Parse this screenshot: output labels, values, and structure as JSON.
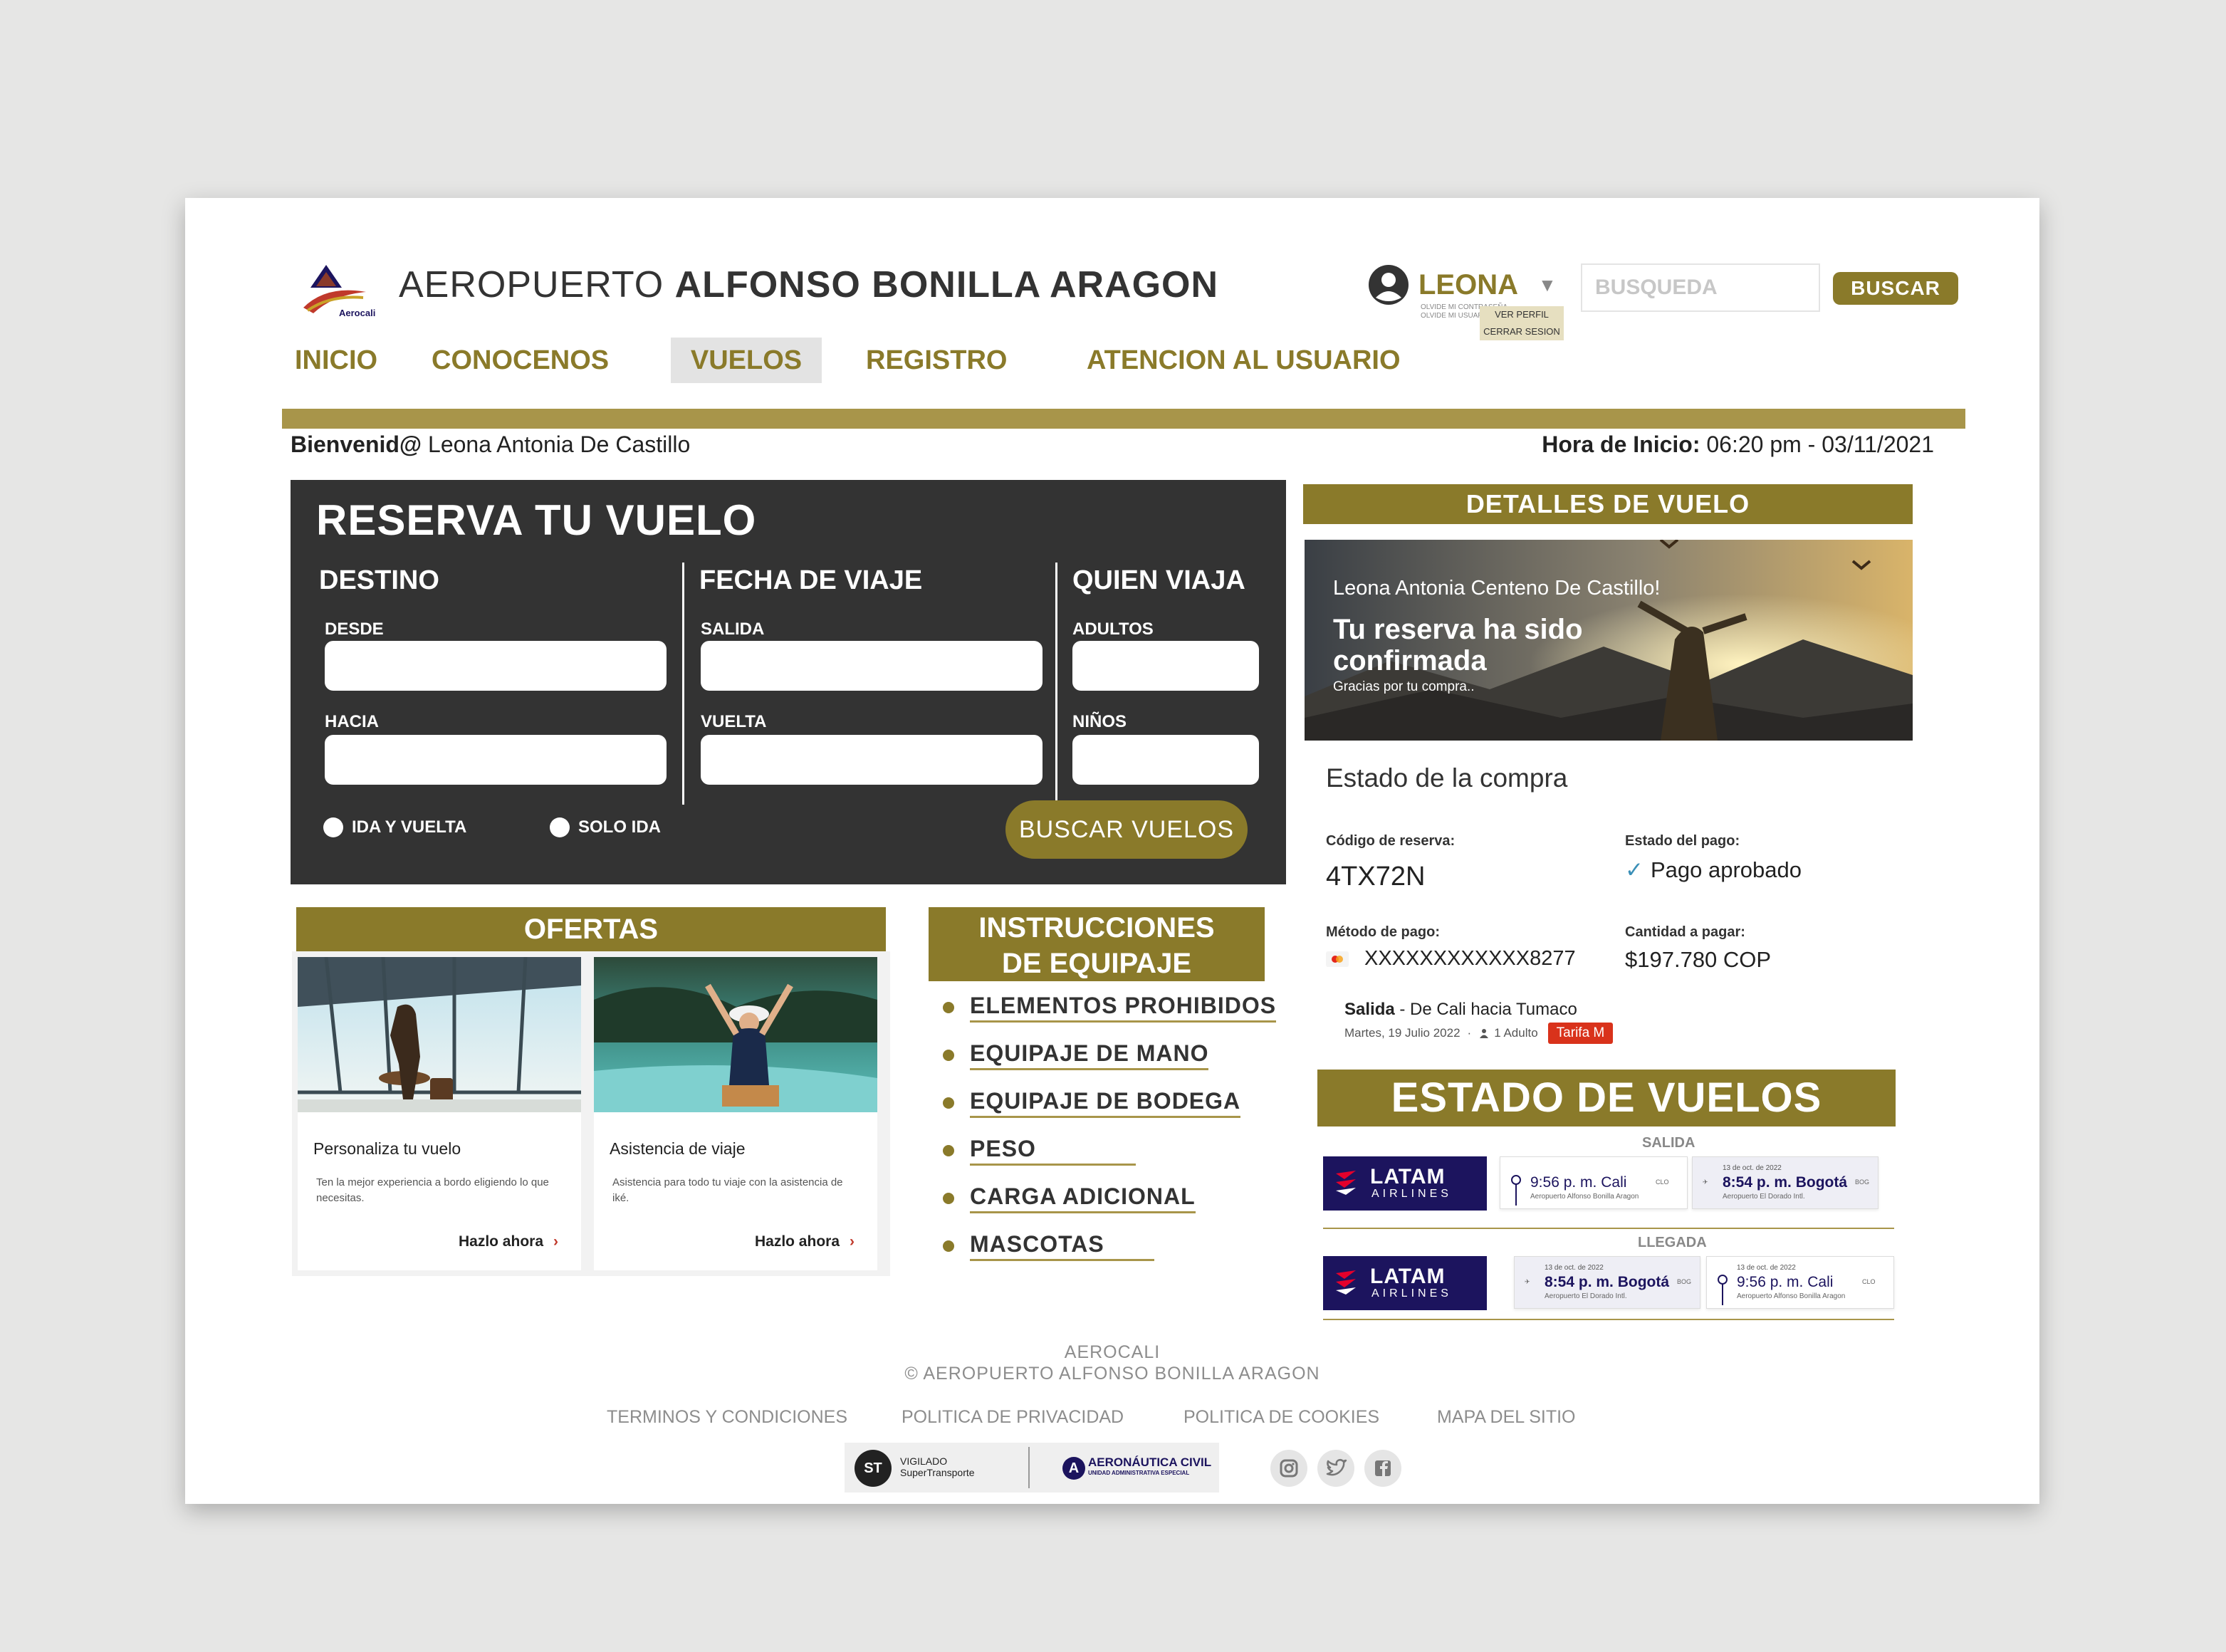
{
  "brand": {
    "logo_text": "Aerocali",
    "title_light": "AEROPUERTO ",
    "title_bold": "ALFONSO BONILLA ARAGON"
  },
  "user": {
    "name": "LEONA",
    "tiny_1": "OLVIDE MI CONTRASEÑA",
    "tiny_2": "OLVIDE MI USUARIO",
    "menu_profile": "VER PERFIL",
    "menu_logout": "CERRAR SESION"
  },
  "search": {
    "placeholder": "BUSQUEDA",
    "button": "BUSCAR"
  },
  "nav": {
    "inicio": "INICIO",
    "conocenos": "CONOCENOS",
    "vuelos": "VUELOS",
    "registro": "REGISTRO",
    "atencion": "ATENCION AL USUARIO"
  },
  "welcome": {
    "label": "Bienvenid@",
    "name": "Leona Antonia De Castillo"
  },
  "start": {
    "label": "Hora de Inicio:",
    "value": "06:20 pm - 03/11/2021"
  },
  "booking": {
    "title": "RESERVA TU VUELO",
    "destino": "DESTINO",
    "desde": "DESDE",
    "hacia": "HACIA",
    "fecha": "FECHA DE VIAJE",
    "salida": "SALIDA",
    "vuelta": "VUELTA",
    "quien": "QUIEN VIAJA",
    "adultos": "ADULTOS",
    "ninos": "NIÑOS",
    "ida_vuelta": "IDA Y VUELTA",
    "solo_ida": "SOLO IDA",
    "button": "BUSCAR VUELOS"
  },
  "ofertas": {
    "title": "OFERTAS",
    "cards": [
      {
        "title": "Personaliza tu vuelo",
        "text": "Ten la mejor experiencia a bordo eligiendo lo que necesitas.",
        "link": "Hazlo ahora"
      },
      {
        "title": "Asistencia de viaje",
        "text": "Asistencia para todo tu viaje con la asistencia de iké.",
        "link": "Hazlo ahora"
      }
    ]
  },
  "instrucciones": {
    "title_1": "INSTRUCCIONES",
    "title_2": "DE EQUIPAJE",
    "items": [
      "ELEMENTOS PROHIBIDOS",
      "EQUIPAJE DE MANO",
      "EQUIPAJE DE BODEGA",
      "PESO",
      "CARGA ADICIONAL",
      "MASCOTAS"
    ]
  },
  "detalles": {
    "title": "DETALLES DE VUELO",
    "banner_name": "Leona Antonia Centeno De Castillo!",
    "banner_msg": "Tu reserva ha sido confirmada",
    "banner_thanks": "Gracias por tu compra..",
    "estado_title": "Estado de la compra",
    "codigo_label": "Código de reserva:",
    "codigo_value": "4TX72N",
    "pago_label": "Estado del pago:",
    "pago_value": "Pago aprobado",
    "metodo_label": "Método de pago:",
    "metodo_value": "XXXXXXXXXXXX8277",
    "cantidad_label": "Cantidad a pagar:",
    "cantidad_value": "$197.780 COP",
    "salida_label": "Salida",
    "salida_route": "- De Cali hacia Tumaco",
    "salida_date": "Martes, 19 Julio 2022",
    "salida_pax": "1 Adulto",
    "tarifa": "Tarifa M"
  },
  "estado_vuelos": {
    "title": "ESTADO DE VUELOS",
    "salida": "SALIDA",
    "llegada": "LLEGADA",
    "airline_1": "LATAM",
    "airline_2": "AIRLINES",
    "rows": [
      {
        "a": {
          "time_pre": "9:56 p. m. ",
          "city": "Cali",
          "code": "CLO",
          "sub": "Aeropuerto Alfonso Bonilla Aragon",
          "date": ""
        },
        "b": {
          "time_pre": "8:54 p. m. ",
          "city": "Bogotá",
          "code": "BOG",
          "sub": "Aeropuerto El Dorado Intl.",
          "date": "13 de oct. de 2022"
        }
      },
      {
        "a": {
          "time_pre": "8:54 p. m. ",
          "city": "Bogotá",
          "code": "BOG",
          "sub": "Aeropuerto El Dorado Intl.",
          "date": "13 de oct. de 2022"
        },
        "b": {
          "time_pre": "9:56 p. m. ",
          "city": "Cali",
          "code": "CLO",
          "sub": "Aeropuerto Alfonso Bonilla Aragon",
          "date": "13 de oct. de 2022"
        }
      }
    ]
  },
  "footer": {
    "brand": "AEROCALI",
    "copyright": "© AEROPUERTO ALFONSO BONILLA ARAGON",
    "terminos": "TERMINOS Y CONDICIONES",
    "privacidad": "POLITICA DE PRIVACIDAD",
    "cookies": "POLITICA DE COOKIES",
    "mapa": "MAPA DEL SITIO",
    "vigilado": "VIGILADO",
    "supertransporte": "SuperTransporte",
    "aeronautica": "AERONÁUTICA CIVIL",
    "aeronautica_sub": "UNIDAD ADMINISTRATIVA ESPECIAL"
  },
  "colors": {
    "gold": "#8a7a2a",
    "gold_light": "#a8954a",
    "panel": "#333333",
    "latam": "#1c145e",
    "tarifa": "#d9321b"
  }
}
